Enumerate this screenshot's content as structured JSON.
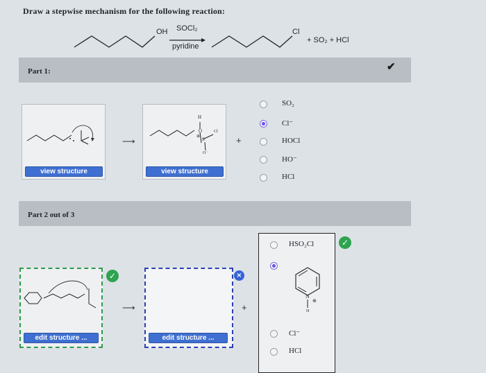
{
  "prompt": "Draw a stepwise mechanism for the following reaction:",
  "reaction": {
    "reactant_oh": "OH",
    "reagent": "SOCl₂",
    "solvent": "pyridine",
    "product_cl": "Cl",
    "byproducts": "+ SO₂ + HCl"
  },
  "part1": {
    "title": "Part 1:",
    "box1_button": "view structure",
    "box2_button": "view structure",
    "box2_labels": {
      "h": "H",
      "o": "O",
      "s": "S",
      "cl": "Cl",
      "charge_pos": "⊕",
      "o_minus": "O⁻"
    },
    "arrow": "⟶",
    "plus": "+",
    "options": [
      {
        "label": "SO₂",
        "selected": false
      },
      {
        "label": "Cl⁻",
        "selected": true
      },
      {
        "label": "HOCl",
        "selected": false
      },
      {
        "label": "HO⁻",
        "selected": false
      },
      {
        "label": "HCl",
        "selected": false
      }
    ],
    "check_mark": "✔"
  },
  "part2": {
    "title": "Part 2 out of 3",
    "box1_button": "edit structure ...",
    "box2_button": "edit structure ...",
    "arrow": "⟶",
    "plus": "+",
    "options": [
      {
        "label": "HSO₂Cl",
        "selected": false
      },
      {
        "label": "",
        "selected": true
      },
      {
        "label": "Cl⁻",
        "selected": false
      },
      {
        "label": "HCl",
        "selected": false
      }
    ],
    "pyridinium": {
      "n": "N",
      "charge": "⊕",
      "h": "H"
    },
    "check_glyph": "✓",
    "x_glyph": "×"
  },
  "colors": {
    "accent_button": "#3f6fd0",
    "correct": "#2ea44f",
    "selected_radio": "#6b52e6"
  }
}
